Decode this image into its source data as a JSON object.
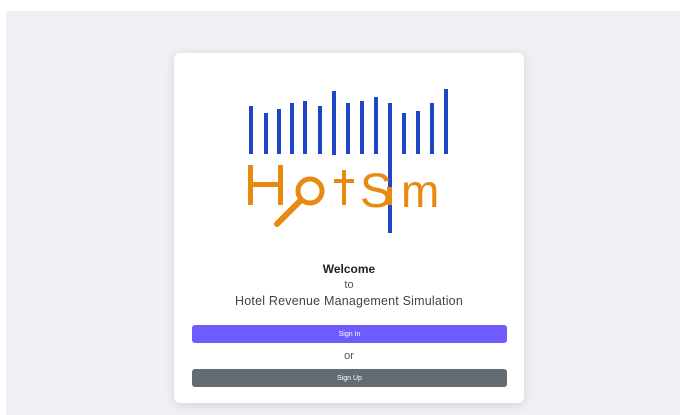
{
  "brand": {
    "logo_text": "HotSim",
    "colors": {
      "bars": "#1e47c7",
      "letters": "#e88a12"
    }
  },
  "welcome": {
    "heading": "Welcome",
    "to": "to",
    "subtitle": "Hotel Revenue Management Simulation"
  },
  "actions": {
    "sign_in_label": "Sign In",
    "or_label": "or",
    "sign_up_label": "Sign Up"
  },
  "colors": {
    "primary": "#6f5cff",
    "secondary": "#626c72",
    "background": "#eef0f4"
  }
}
